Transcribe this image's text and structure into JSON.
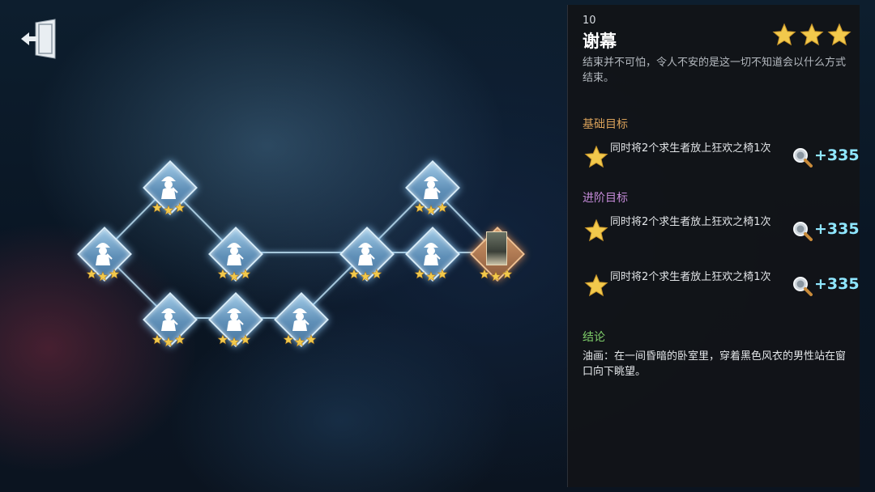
{
  "panel": {
    "stage_number": "10",
    "stage_title": "谢幕",
    "rating_stars": 3,
    "description": "结束并不可怕，令人不安的是这一切不知道会以什么方式结束。",
    "basic_label": "基础目标",
    "advanced_label": "进阶目标",
    "conclusion_label": "结论",
    "conclusion_text": "油画：在一间昏暗的卧室里，穿着黑色风衣的男性站在窗口向下眺望。",
    "basic_objectives": [
      {
        "text": "同时将2个求生者放上狂欢之椅1次",
        "reward": "+335"
      }
    ],
    "advanced_objectives": [
      {
        "text": "同时将2个求生者放上狂欢之椅1次",
        "reward": "+335"
      },
      {
        "text": "同时将2个求生者放上狂欢之椅1次",
        "reward": "+335"
      }
    ]
  },
  "map": {
    "stars_per_node": 3,
    "nodes": [
      {
        "id": "n1",
        "col": 0,
        "row": "mid"
      },
      {
        "id": "n2",
        "col": 1,
        "row": "top"
      },
      {
        "id": "n3",
        "col": 1,
        "row": "bottom"
      },
      {
        "id": "n4",
        "col": 2,
        "row": "mid"
      },
      {
        "id": "n5",
        "col": 2,
        "row": "bottom"
      },
      {
        "id": "n6",
        "col": 3,
        "row": "bottom"
      },
      {
        "id": "n7",
        "col": 4,
        "row": "mid"
      },
      {
        "id": "n8",
        "col": 5,
        "row": "top"
      },
      {
        "id": "n9",
        "col": 5,
        "row": "mid"
      },
      {
        "id": "n10",
        "col": 6,
        "row": "mid",
        "final": true
      }
    ]
  },
  "colors": {
    "basic_label": "#d9a15a",
    "advanced_label": "#c48ad8",
    "conclusion_label": "#7fcf6a",
    "reward": "#8fe6ff",
    "star": "#f2c94c"
  },
  "icons": {
    "exit": "exit-door-icon",
    "node": "detective-icon",
    "objective_star": "star-icon",
    "clue": "magnifier-icon"
  }
}
